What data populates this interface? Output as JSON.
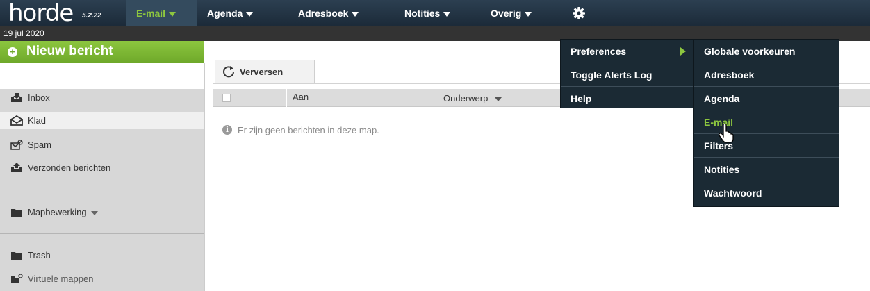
{
  "app": {
    "logo_text": "horde",
    "version": "5.2.22"
  },
  "topnav": {
    "items": [
      {
        "label": "E-mail",
        "active": true
      },
      {
        "label": "Agenda"
      },
      {
        "label": "Adresboek"
      },
      {
        "label": "Notities"
      },
      {
        "label": "Overig"
      }
    ],
    "settings_icon": "gear-icon"
  },
  "date": "19 jul 2020",
  "sidebar": {
    "new_message": "Nieuw bericht",
    "folders": [
      {
        "label": "Inbox",
        "icon": "inbox-icon"
      },
      {
        "label": "Klad",
        "icon": "drafts-icon",
        "selected": true
      },
      {
        "label": "Spam",
        "icon": "spam-icon"
      },
      {
        "label": "Verzonden berichten",
        "icon": "sent-icon"
      }
    ],
    "folder_actions": "Mapbewerking",
    "trash": "Trash",
    "virtual": "Virtuele mappen"
  },
  "toolbar": {
    "refresh": "Verversen"
  },
  "table": {
    "columns": [
      "Aan",
      "Onderwerp"
    ],
    "empty_message": "Er zijn geen berichten in deze map."
  },
  "menu": {
    "main": [
      "Preferences",
      "Toggle Alerts Log",
      "Help"
    ],
    "preferences": [
      "Globale voorkeuren",
      "Adresboek",
      "Agenda",
      "E-mail",
      "Filters",
      "Notities",
      "Wachtwoord"
    ]
  },
  "colors": {
    "nav_bg": "#1b2a38",
    "accent_green": "#8dc63f",
    "menu_bg": "#1b2a34"
  }
}
